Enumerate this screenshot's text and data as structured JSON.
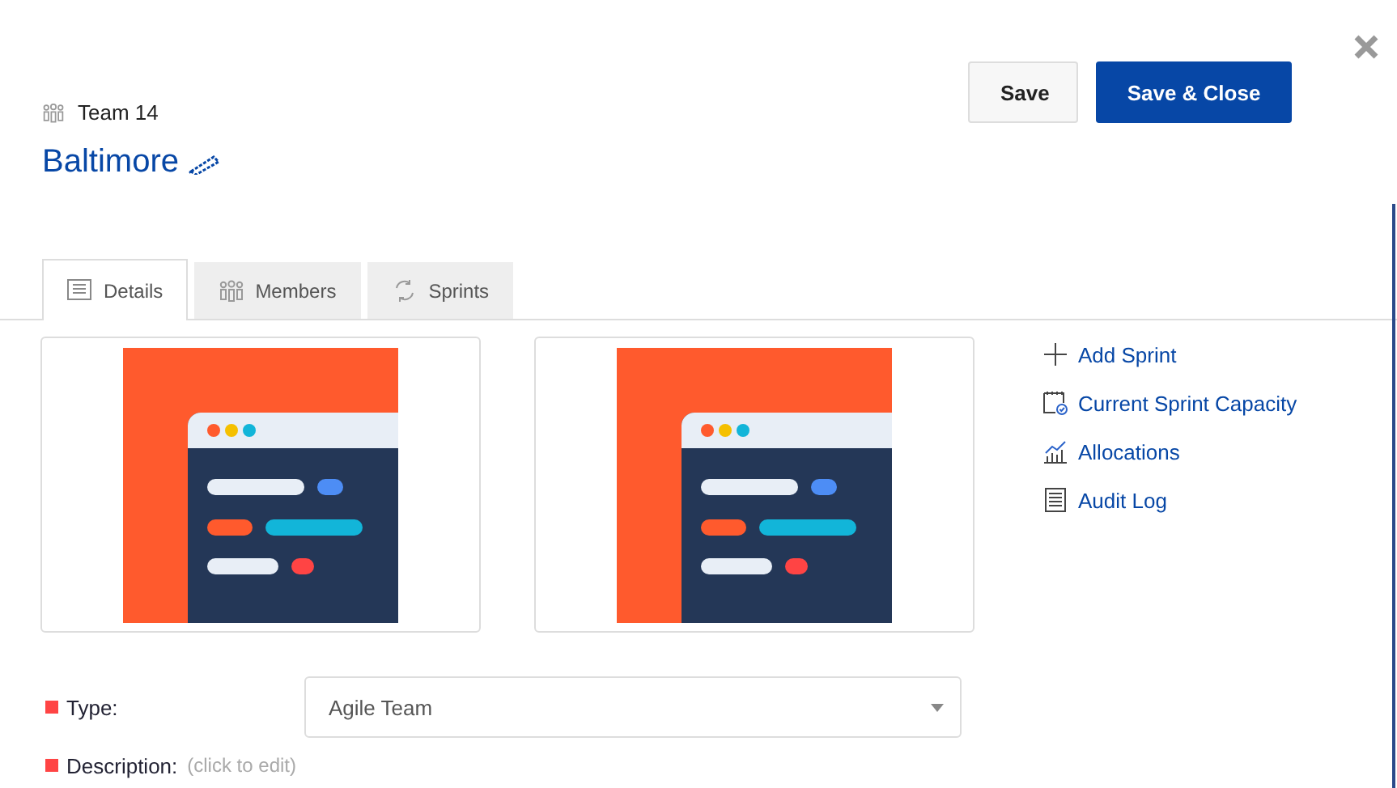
{
  "header": {
    "team_label": "Team 14",
    "title": "Baltimore"
  },
  "buttons": [
    {
      "label": "Save",
      "kind": "secondary"
    },
    {
      "label": "Save & Close",
      "kind": "primary"
    }
  ],
  "tabs": [
    {
      "label": "Details",
      "selected": true,
      "kind": "details"
    },
    {
      "label": "Members",
      "selected": false,
      "kind": "members"
    },
    {
      "label": "Sprints",
      "selected": false,
      "kind": "sprints"
    }
  ],
  "images": [
    {
      "kind": "app-illustration"
    },
    {
      "kind": "app-illustration"
    }
  ],
  "actions": [
    {
      "label": "Add Sprint",
      "kind": "plus"
    },
    {
      "label": "Current Sprint Capacity",
      "kind": "calendar"
    },
    {
      "label": "Allocations",
      "kind": "chart"
    },
    {
      "label": "Audit Log",
      "kind": "log"
    }
  ],
  "fields": [
    {
      "label": "Type:",
      "kind": "select",
      "value": "Agile Team",
      "required": true
    },
    {
      "label": "Description:",
      "kind": "text",
      "placeholder": "(click to edit)",
      "required": true
    }
  ]
}
